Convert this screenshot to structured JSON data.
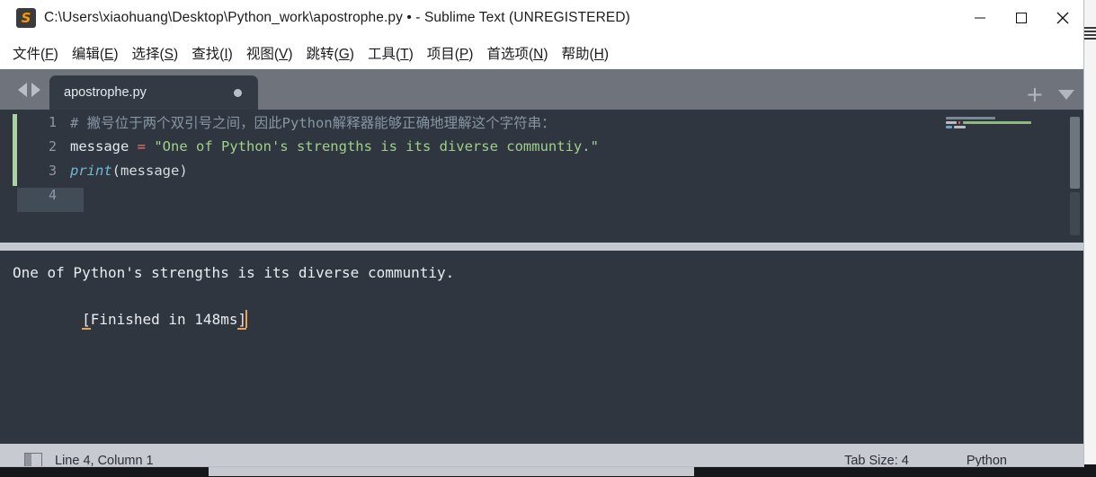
{
  "window": {
    "title": "C:\\Users\\xiaohuang\\Desktop\\Python_work\\apostrophe.py • - Sublime Text (UNREGISTERED)",
    "app_icon": "sublime-text-icon",
    "controls": {
      "minimize": "minimize-icon",
      "maximize": "maximize-icon",
      "close": "close-icon"
    }
  },
  "menubar": {
    "items": [
      {
        "label": "文件",
        "mnemonic": "F"
      },
      {
        "label": "编辑",
        "mnemonic": "E"
      },
      {
        "label": "选择",
        "mnemonic": "S"
      },
      {
        "label": "查找",
        "mnemonic": "I"
      },
      {
        "label": "视图",
        "mnemonic": "V"
      },
      {
        "label": "跳转",
        "mnemonic": "G"
      },
      {
        "label": "工具",
        "mnemonic": "T"
      },
      {
        "label": "项目",
        "mnemonic": "P"
      },
      {
        "label": "首选项",
        "mnemonic": "N"
      },
      {
        "label": "帮助",
        "mnemonic": "H"
      }
    ]
  },
  "tabbar": {
    "prev_icon": "arrow-left-icon",
    "next_icon": "arrow-right-icon",
    "tabs": [
      {
        "label": "apostrophe.py",
        "modified": true
      }
    ],
    "new_tab_label": "+",
    "tab_menu_icon": "chevron-down-icon"
  },
  "editor": {
    "lines": [
      {
        "number": "1",
        "tokens": [
          {
            "text": "# 撇号位于两个双引号之间，因此Python解释器能够正确地理解这个字符串：",
            "type": "comment"
          }
        ]
      },
      {
        "number": "2",
        "tokens": [
          {
            "text": "message ",
            "type": "var"
          },
          {
            "text": "= ",
            "type": "op"
          },
          {
            "text": "\"One of Python's strengths is its diverse communtiy.\"",
            "type": "str"
          }
        ]
      },
      {
        "number": "3",
        "tokens": [
          {
            "text": "print",
            "type": "fn"
          },
          {
            "text": "(message)",
            "type": "plain"
          }
        ]
      },
      {
        "number": "4",
        "tokens": []
      }
    ],
    "current_line": 4
  },
  "output": {
    "lines": [
      "One of Python's strengths is its diverse communtiy.",
      "[Finished in 148ms]"
    ],
    "finished_prefix": "[",
    "finished_body": "Finished in 148ms",
    "finished_suffix": "]"
  },
  "statusbar": {
    "sidebar_toggle_icon": "sidebar-toggle-icon",
    "cursor_position": "Line 4, Column 1",
    "tab_size": "Tab Size: 4",
    "syntax": "Python"
  },
  "colors": {
    "editor_bg": "#2f3640",
    "panel_bg": "#2f3640",
    "tabbar_bg": "#6e737c",
    "statusbar_bg": "#c7cad1",
    "string": "#9fd08a",
    "comment": "#8795a3",
    "operator": "#f0776a",
    "function": "#6fb8d6",
    "accent_orange": "#f0a04b",
    "modified_marker": "#a9d3a0"
  }
}
